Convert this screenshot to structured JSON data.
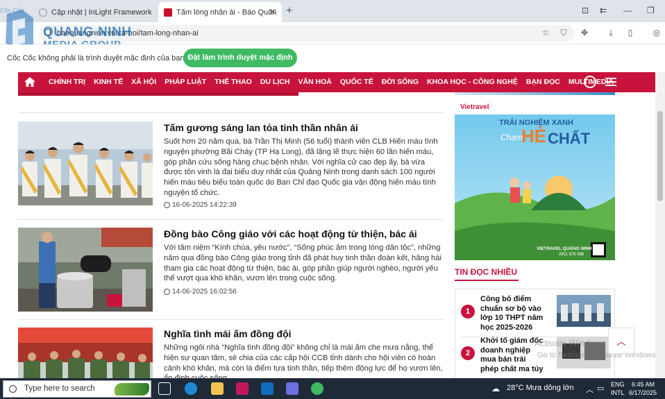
{
  "browser": {
    "tabs": [
      {
        "title": "Cập nhật | InLight Framework",
        "active": false
      },
      {
        "title": "Tấm lòng nhân ái - Báo Quản",
        "active": true
      }
    ],
    "url": "baoquangninh.vn/xa-hoi/tam-long-nhan-ai",
    "default_bar": {
      "message": "Cốc Cốc không phải là trình duyệt mặc định của bạn",
      "button": "Đặt làm trình duyệt mặc định"
    },
    "new_tab_glyph": "+",
    "close_glyph": "✕"
  },
  "logo": {
    "line1": "QUANG NINH",
    "line2": "MEDIA GROUP",
    "small": "Cốc Cốc"
  },
  "nav": {
    "items": [
      "CHÍNH TRỊ",
      "KINH TẾ",
      "XÃ HỘI",
      "PHÁP LUẬT",
      "THỂ THAO",
      "DU LỊCH",
      "VĂN HOÁ",
      "QUỐC TẾ",
      "ĐỜI SỐNG",
      "KHOA HỌC - CÔNG NGHỆ",
      "BẠN ĐỌC",
      "MULTIMEDIA"
    ],
    "colors": {
      "brand": "#c8143c"
    }
  },
  "articles": [
    {
      "title": "Tấm gương sáng lan tỏa tinh thần nhân ái",
      "summary": "Suốt hơn 20 năm qua, bà Trần Thị Minh (56 tuổi) thành viên CLB Hiến máu tình nguyện phường Bãi Cháy (TP Hạ Long), đã lặng lẽ thực hiện 60 lần hiến máu, góp phần cứu sống hàng chục bệnh nhân. Với nghĩa cử cao đẹp ấy, bà vừa được tôn vinh là đại biểu duy nhất của Quảng Ninh trong danh sách 100 người hiến máu tiêu biểu toàn quốc do Ban Chỉ đạo Quốc gia vận động hiến máu tình nguyện tổ chức.",
      "date": "16-06-2025 14:22:39"
    },
    {
      "title": "Đồng bào Công giáo với các hoạt động từ thiện, bác ái",
      "summary": "Với tâm niệm “Kính chúa, yêu nước”, “Sống phúc âm trong lòng dân tộc”, những năm qua đồng bào Công giáo trong tỉnh đã phát huy tinh thần đoàn kết, hăng hái tham gia các hoạt động từ thiện, bác ái, góp phần giúp người nghèo, người yếu thế vượt qua khó khăn, vươn lên trong cuộc sống.",
      "date": "14-06-2025 16:02:56"
    },
    {
      "title": "Nghĩa tình mái ấm đồng đội",
      "summary": "Những ngôi nhà “Nghĩa tình đồng đội” không chỉ là mái ấm che mưa nắng, thể hiện sự quan tâm, sẻ chia của các cấp hội CCB tỉnh dành cho hội viên có hoàn cảnh khó khăn, mà còn là điểm tựa tinh thần, tiếp thêm động lực để họ vươn lên, ổn định cuộc sống.",
      "date": ""
    }
  ],
  "ad": {
    "brand": "Vietravel",
    "headline": "TRẢI NGHIỆM XANH",
    "script": "Chạm",
    "big1": "HÈ",
    "big2": "CHẤT",
    "footer": "VIETRAVEL QUẢNG NINH",
    "phone": "0911 676 588"
  },
  "sidebar": {
    "heading": "TIN ĐỌC NHIỀU",
    "items": [
      {
        "num": "1",
        "title": "Công bố điểm chuẩn sơ bộ vào lớp 10 THPT năm học 2025-2026"
      },
      {
        "num": "2",
        "title": "Khởi tố giám đốc doanh nghiệp mua bán trái phép chất ma túy"
      }
    ]
  },
  "overlay": {
    "activate1": "Activate Windows",
    "activate2": "Go to Settings to activate Windows."
  },
  "taskbar": {
    "search_placeholder": "Type here to search",
    "weather": "28°C  Mưa dông lớn",
    "lang1": "ENG",
    "lang2": "INTL",
    "time": "6:45 AM",
    "date": "6/17/2025"
  }
}
